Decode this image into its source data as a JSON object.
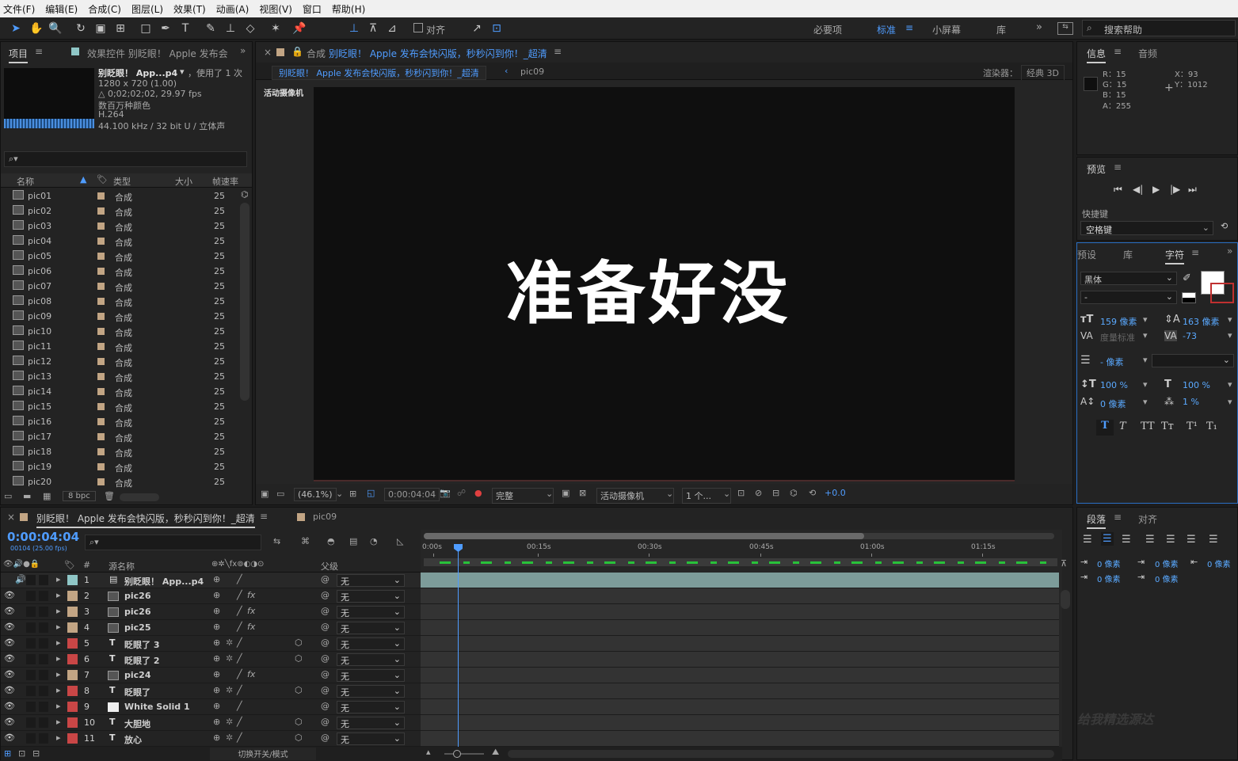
{
  "menu": [
    "文件(F)",
    "编辑(E)",
    "合成(C)",
    "图层(L)",
    "效果(T)",
    "动画(A)",
    "视图(V)",
    "窗口",
    "帮助(H)"
  ],
  "toolbar": {
    "snap_label": "对齐",
    "workspaces": [
      "必要项",
      "标准",
      "小屏幕",
      "库"
    ],
    "active_workspace": "标准",
    "search_placeholder": "搜索帮助"
  },
  "project": {
    "tab_label": "项目",
    "effects_tab": "效果控件 别眨眼！ Apple 发布会",
    "item_name": "别眨眼！ App...p4",
    "used_count": "，使用了 1 次",
    "resolution": "1280 x 720 (1.00)",
    "duration": "△ 0;02;02;02, 29.97 fps",
    "colors": "数百万种颜色",
    "codec": "H.264",
    "audio": "44.100 kHz / 32 bit U / 立体声",
    "columns": [
      "名称",
      "类型",
      "大小",
      "帧速率"
    ],
    "items": [
      {
        "name": "pic01",
        "type": "合成",
        "fps": "25"
      },
      {
        "name": "pic02",
        "type": "合成",
        "fps": "25"
      },
      {
        "name": "pic03",
        "type": "合成",
        "fps": "25"
      },
      {
        "name": "pic04",
        "type": "合成",
        "fps": "25"
      },
      {
        "name": "pic05",
        "type": "合成",
        "fps": "25"
      },
      {
        "name": "pic06",
        "type": "合成",
        "fps": "25"
      },
      {
        "name": "pic07",
        "type": "合成",
        "fps": "25"
      },
      {
        "name": "pic08",
        "type": "合成",
        "fps": "25"
      },
      {
        "name": "pic09",
        "type": "合成",
        "fps": "25"
      },
      {
        "name": "pic10",
        "type": "合成",
        "fps": "25"
      },
      {
        "name": "pic11",
        "type": "合成",
        "fps": "25"
      },
      {
        "name": "pic12",
        "type": "合成",
        "fps": "25"
      },
      {
        "name": "pic13",
        "type": "合成",
        "fps": "25"
      },
      {
        "name": "pic14",
        "type": "合成",
        "fps": "25"
      },
      {
        "name": "pic15",
        "type": "合成",
        "fps": "25"
      },
      {
        "name": "pic16",
        "type": "合成",
        "fps": "25"
      },
      {
        "name": "pic17",
        "type": "合成",
        "fps": "25"
      },
      {
        "name": "pic18",
        "type": "合成",
        "fps": "25"
      },
      {
        "name": "pic19",
        "type": "合成",
        "fps": "25"
      },
      {
        "name": "pic20",
        "type": "合成",
        "fps": "25"
      }
    ],
    "bpc": "8 bpc"
  },
  "composition": {
    "tab_prefix": "合成",
    "tab_name": "别眨眼！ Apple 发布会快闪版，秒秒闪到你！_超清",
    "breadcrumb_active": "别眨眼！ Apple 发布会快闪版，秒秒闪到你！_超清",
    "breadcrumb_next": "pic09",
    "renderer_label": "渲染器：",
    "renderer_value": "经典 3D",
    "camera_label": "活动摄像机",
    "viewer_text": "准备好没",
    "zoom": "(46.1%)",
    "timecode": "0:00:04:04",
    "resolution": "完整",
    "camera_select": "活动摄像机",
    "views": "1 个...",
    "exposure": "+0.0"
  },
  "info": {
    "tab_info": "信息",
    "tab_audio": "音频",
    "r": "R：15",
    "g": "G：15",
    "b": "B：15",
    "a": "A：255",
    "x": "X：93",
    "y": "Y：1012"
  },
  "preview": {
    "tab": "预览",
    "shortcut_label": "快捷键",
    "shortcut_value": "空格键"
  },
  "character": {
    "tabs": [
      "预设",
      "库",
      "字符"
    ],
    "font": "黑体",
    "style": "-",
    "size": "159 像素",
    "leading": "163 像素",
    "kerning": "度量标准",
    "tracking": "-73",
    "stroke": "- 像素",
    "vscale": "100 %",
    "hscale": "100 %",
    "baseline": "0 像素",
    "tsume": "1 %"
  },
  "paragraph": {
    "tab": "段落",
    "tab_align": "对齐",
    "indent_values": [
      "0 像素",
      "0 像素",
      "0 像素",
      "0 像素",
      "0 像素"
    ]
  },
  "timeline": {
    "comp_tab": "别眨眼！ Apple 发布会快闪版，秒秒闪到你！_超清",
    "other_tab": "pic09",
    "timecode": "0:00:04:04",
    "frame_info": "00104 (25.00 fps)",
    "col_source": "源名称",
    "col_parent": "父级",
    "ruler": [
      "0:00s",
      "00:15s",
      "00:30s",
      "00:45s",
      "01:00s",
      "01:15s"
    ],
    "toggle_label": "切换开关/模式",
    "layers": [
      {
        "num": "1",
        "name": "别眨眼！ App...p4",
        "color": "#8fc6c6",
        "kind": "footage",
        "parent": "无"
      },
      {
        "num": "2",
        "name": "pic26",
        "color": "#c2a584",
        "kind": "comp",
        "parent": "无"
      },
      {
        "num": "3",
        "name": "pic26",
        "color": "#c2a584",
        "kind": "comp",
        "parent": "无"
      },
      {
        "num": "4",
        "name": "pic25",
        "color": "#c2a584",
        "kind": "comp",
        "parent": "无"
      },
      {
        "num": "5",
        "name": "眨眼了 3",
        "color": "#c94646",
        "kind": "text",
        "parent": "无"
      },
      {
        "num": "6",
        "name": "眨眼了 2",
        "color": "#c94646",
        "kind": "text",
        "parent": "无"
      },
      {
        "num": "7",
        "name": "pic24",
        "color": "#c2a584",
        "kind": "comp",
        "parent": "无"
      },
      {
        "num": "8",
        "name": "眨眼了",
        "color": "#c94646",
        "kind": "text",
        "parent": "无"
      },
      {
        "num": "9",
        "name": "White Solid 1",
        "color": "#c94646",
        "kind": "solid",
        "parent": "无"
      },
      {
        "num": "10",
        "name": "大胆地",
        "color": "#c94646",
        "kind": "text",
        "parent": "无"
      },
      {
        "num": "11",
        "name": "放心",
        "color": "#c94646",
        "kind": "text",
        "parent": "无"
      }
    ],
    "watermark": "给我精选源达"
  }
}
